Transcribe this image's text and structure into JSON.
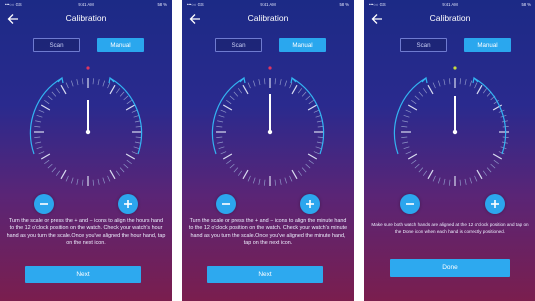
{
  "status_bar": {
    "carrier": "•••○○ GS ",
    "time": "9:41 AM",
    "battery": "58 %"
  },
  "nav": {
    "title": "Calibration"
  },
  "segments": {
    "scan": "Scan",
    "manual": "Manual",
    "selected": "manual"
  },
  "dial": {
    "top_marker_colors": [
      "#e0355f",
      "#e0355f",
      "#c8dc3c"
    ]
  },
  "screens": [
    {
      "instructions": "Turn the scale or press the + and − icons to align the hours hand to the 12 o'clock position on the watch. Check your watch's hour hand as you turn the scale.Once you've aligned the hour hand, tap on the next icon.",
      "button": "Next"
    },
    {
      "instructions": "Turn the scale or press the + and − icons to align the minute hand to the 12 o'clock position on the watch. Check your watch's minute hand as you turn the scale.Once you've aligned the minute hand, tap on the next icon.",
      "button": "Next"
    },
    {
      "instructions": "Make sure both watch hands are aligned at the 12 o'clock position and tap on the Done icon when each hand is correctly positioned.",
      "button": "Done"
    }
  ],
  "colors": {
    "accent": "#2aa7ee",
    "bg_top": "#1c2a86",
    "bg_bottom": "#7a1e4e"
  }
}
